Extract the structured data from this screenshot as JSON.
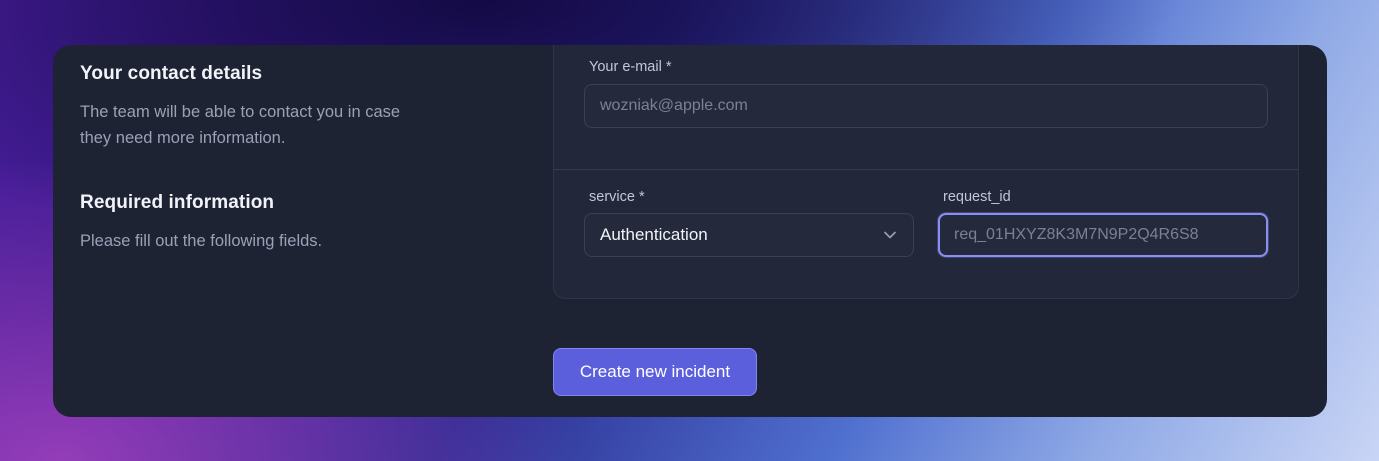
{
  "contact_section": {
    "title": "Your contact details",
    "description_line1": "The team will be able to contact you in case",
    "description_line2": "they need more information."
  },
  "required_section": {
    "title": "Required information",
    "description": "Please fill out the following fields."
  },
  "form": {
    "email": {
      "label": "Your e-mail *",
      "placeholder": "wozniak@apple.com"
    },
    "service": {
      "label": "service *",
      "selected": "Authentication"
    },
    "request_id": {
      "label": "request_id",
      "placeholder": "req_01HXYZ8K3M7N9P2Q4R6S8"
    }
  },
  "submit": {
    "label": "Create new incident"
  },
  "colors": {
    "accent": "#5b5fdc",
    "card_bg": "#1e2334",
    "focus_ring": "#8a8ef2"
  },
  "icons": {
    "select_chevron": "chevron-down-icon"
  }
}
